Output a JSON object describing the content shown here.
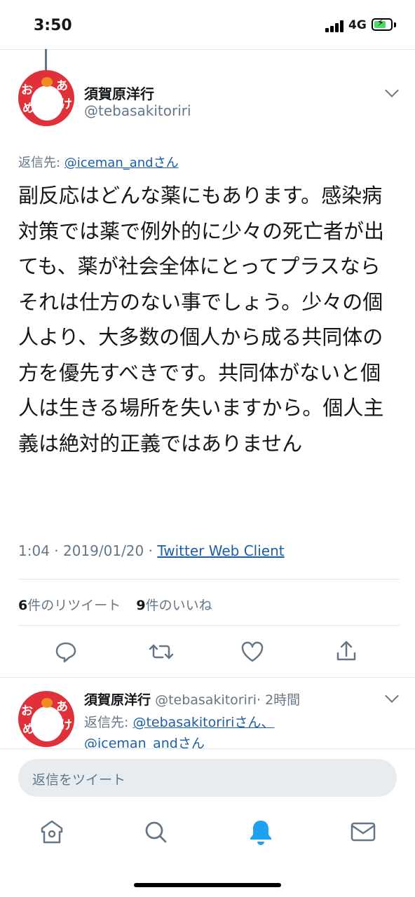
{
  "status_bar": {
    "time": "3:50",
    "network": "4G"
  },
  "tweet": {
    "author_name": "須賀原洋行",
    "author_handle": "@tebasakitoriri",
    "avatar_text": [
      "お",
      "め",
      "あ",
      "け"
    ],
    "reply_prefix": "返信先: ",
    "reply_target": "@iceman_andさん",
    "body": "副反応はどんな薬にもあります。感染病対策では薬で例外的に少々の死亡者が出ても、薬が社会全体にとってプラスならそれは仕方のない事でしょう。少々の個人より、大多数の個人から成る共同体の方を優先すべきです。共同体がないと個人は生きる場所を失いますから。個人主義は絶対的正義ではありません",
    "timestamp": "1:04 · 2019/01/20 · ",
    "client": "Twitter Web Client",
    "retweet_count": "6",
    "retweet_label": "件のリツイート",
    "like_count": "9",
    "like_label": "件のいいね"
  },
  "reply_tweet": {
    "author_name": "須賀原洋行",
    "author_handle": "@tebasakitoriri",
    "time_ago": "· 2時間",
    "reply_prefix": "返信先: ",
    "reply_target_1": "@tebasakitoririさん、",
    "reply_target_2": "@iceman_andさん"
  },
  "compose": {
    "placeholder": "返信をツイート"
  },
  "actions": [
    "reply-icon",
    "retweet-icon",
    "like-icon",
    "share-icon"
  ],
  "bottom_nav": [
    "home-icon",
    "search-icon",
    "notifications-icon",
    "messages-icon"
  ],
  "colors": {
    "link": "#1b5fa8",
    "muted": "#657786",
    "active_nav": "#1da1f2",
    "avatar_red": "#e0303a"
  }
}
